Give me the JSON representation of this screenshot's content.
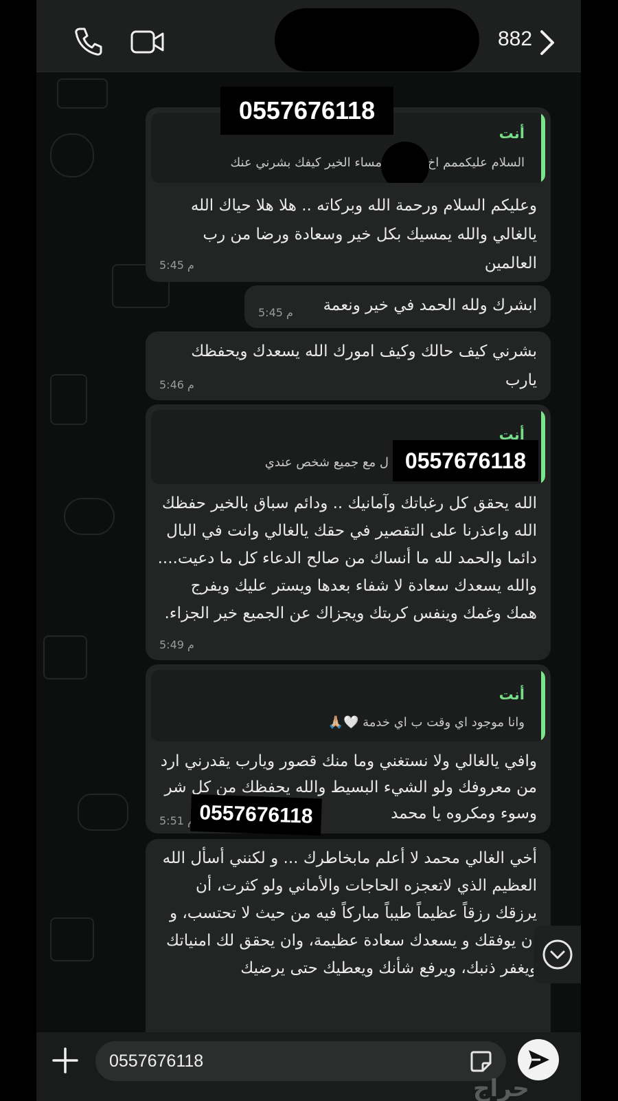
{
  "header": {
    "contact_number": "882",
    "icons": [
      "phone-icon",
      "video-call-icon",
      "chevron-right-icon"
    ]
  },
  "redacted_number": "0557676118",
  "messages": [
    {
      "reply": {
        "sender": "أنت",
        "quote_right": "السلام عليكممم اخ",
        "quote_left": "مساء الخير كيفك بشرني عنك"
      },
      "text": "وعليكم السلام ورحمة الله وبركاته .. هلا هلا حياك الله يالغالي والله يمسيك بكل خير وسعادة ورضا من رب العالمين",
      "time": "5:45 م"
    },
    {
      "text": "ابشرك ولله الحمد في خير ونعمة",
      "time": "5:45 م"
    },
    {
      "text": "بشرني كيف حالك وكيف امورك الله يسعدك ويحفظك يارب",
      "time": "5:46 م"
    },
    {
      "reply": {
        "sender": "أنت",
        "quote_right": "",
        "quote_left": "ل مع جميع شخص عندي"
      },
      "text": "الله يحقق كل رغباتك وآمانيك .. ودائم سباق بالخير حفظك الله واعذرنا على التقصير في حقك يالغالي وانت في البال دائما والحمد لله ما أنساك من صالح الدعاء كل ما دعيت.... والله يسعدك سعادة لا شفاء بعدها ويستر عليك ويفرج همك وغمك وينفس كربتك ويجزاك عن الجميع خير الجزاء.",
      "time": "5:49 م"
    },
    {
      "reply": {
        "sender": "أنت",
        "quote_right": "وانا موجود اي وقت ب اي خدمة 🤍🙏🏼",
        "quote_left": ""
      },
      "text": "وافي يالغالي ولا نستغني وما منك قصور ويارب يقدرني ارد من معروفك ولو الشيء البسيط والله يحفظك من كل شر وسوء ومكروه يا محمد",
      "time": "5:51 م"
    },
    {
      "text": "أخي الغالي محمد لا أعلم مابخاطرك ... و لكنني أسأل الله العظيم الذي لاتعجزه الحاجات والأماني ولو كثرت، أن يرزقك رزقاً عظيماً طيباً مباركاً فيه من حيث لا تحتسب، و ان يوفقك و يسعدك سعادة عظيمة، وان يحقق لك امنياتك ويغفر ذنبك، ويرفع شأنك ويعطيك حتى يرضيك",
      "time": ""
    }
  ],
  "input": {
    "value": "0557676118"
  },
  "watermark": "حراج"
}
